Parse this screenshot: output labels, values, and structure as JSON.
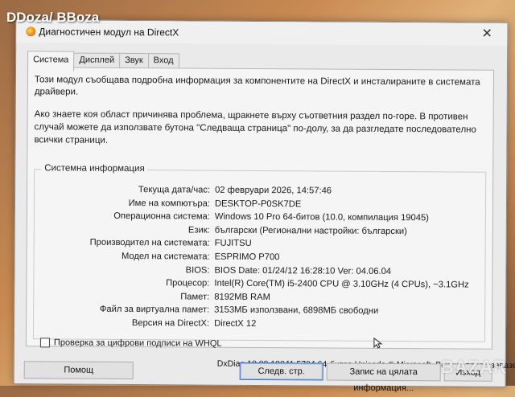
{
  "watermark": "DDoza/ BBoza",
  "window": {
    "title": "Диагностичен модул на DirectX",
    "close_glyph": "✕"
  },
  "tabs": [
    {
      "label": "Система",
      "active": true
    },
    {
      "label": "Дисплей",
      "active": false
    },
    {
      "label": "Звук",
      "active": false
    },
    {
      "label": "Вход",
      "active": false
    }
  ],
  "intro": "Този модул съобщава подробна информация за компонентите на DirectX и инсталираните в системата драйвери.",
  "hint": "Ако знаете коя област причинява проблема, щракнете върху съответния раздел по-горе. В противен случай можете да използвате бутона \"Следваща страница\" по-долу, за да разгледате последователно всички страници.",
  "system_info": {
    "title": "Системна информация",
    "rows": [
      {
        "label": "Текуща дата/час:",
        "value": "02 февруари 2026, 14:57:46"
      },
      {
        "label": "Име на компютъра:",
        "value": "DESKTOP-P0SK7DE"
      },
      {
        "label": "Операционна система:",
        "value": "Windows 10 Pro 64-битов (10.0, компилация 19045)"
      },
      {
        "label": "Език:",
        "value": "български (Регионални настройки: български)"
      },
      {
        "label": "Производител на системата:",
        "value": "FUJITSU"
      },
      {
        "label": "Модел на системата:",
        "value": "ESPRIMO P700"
      },
      {
        "label": "BIOS:",
        "value": "BIOS Date: 01/24/12 16:28:10 Ver: 04.06.04"
      },
      {
        "label": "Процесор:",
        "value": "Intel(R) Core(TM) i5-2400 CPU @ 3.10GHz (4 CPUs), ~3.1GHz"
      },
      {
        "label": "Памет:",
        "value": "8192MB RAM"
      },
      {
        "label": "Файл за виртуална памет:",
        "value": "3153МБ използвани, 6898МБ свободни"
      },
      {
        "label": "Версия на DirectX:",
        "value": "DirectX 12"
      }
    ]
  },
  "whql_label": "Проверка за цифрови подписи на WHQL",
  "whql_checked": false,
  "copyright": "DxDiag 10.00.19041.5794 64-битов Unicode © Microsoft. Всички права запазени.",
  "buttons": {
    "help": "Помощ",
    "next_page": "Следв. стр.",
    "save_all": "Запис на цялата информация...",
    "exit": "Изход"
  },
  "bazar_logo": "BAZAR"
}
